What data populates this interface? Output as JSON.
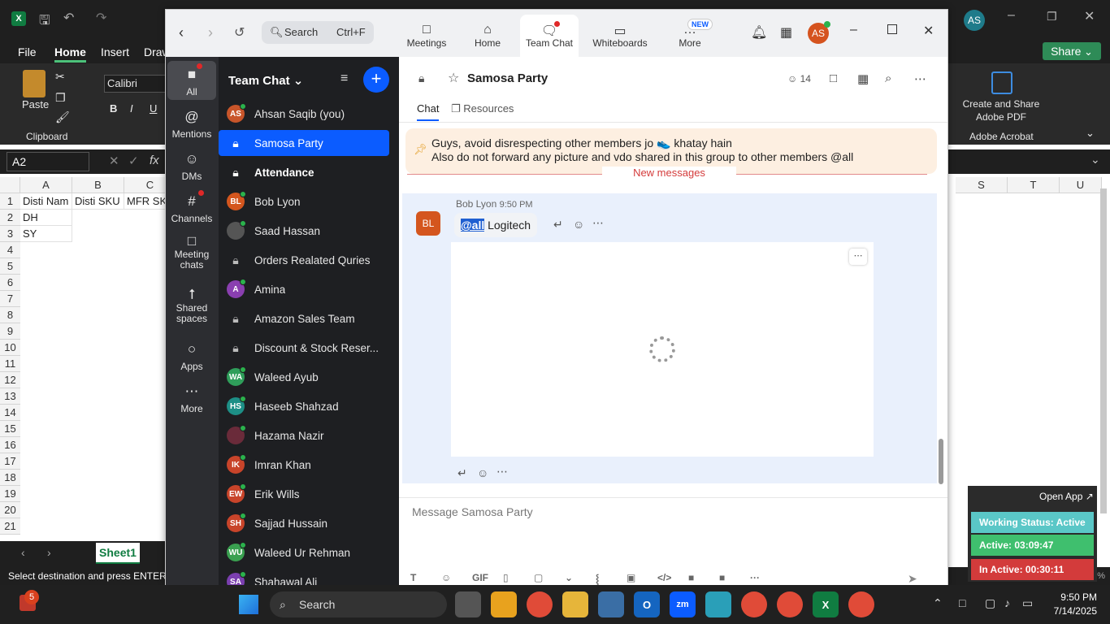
{
  "excel": {
    "menu_tabs": [
      "File",
      "Home",
      "Insert",
      "Draw"
    ],
    "font_name": "Calibri",
    "paste_label": "Paste",
    "clipboard_label": "Clipboard",
    "name_box": "A2",
    "create_share_pdf": "Create and Share Adobe PDF",
    "adobe_acrobat": "Adobe Acrobat",
    "share_label": "Share",
    "columns_left": [
      "A",
      "B",
      "C"
    ],
    "columns_right": [
      "S",
      "T",
      "U"
    ],
    "rows": [
      "1",
      "2",
      "3",
      "4",
      "5",
      "6",
      "7",
      "8",
      "9",
      "10",
      "11",
      "12",
      "13",
      "14",
      "15",
      "16",
      "17",
      "18",
      "19",
      "20",
      "21"
    ],
    "cells": {
      "A1": "Disti Nam",
      "B1": "Disti SKU",
      "C1": "MFR SK",
      "A2": "DH",
      "A3": "SY"
    },
    "sheet_tab": "Sheet1",
    "status_text": "Select destination and press ENTER or",
    "zoom_pct": "100%",
    "user_initials": "AS"
  },
  "zoom": {
    "search_placeholder": "Search",
    "search_shortcut": "Ctrl+F",
    "top_tabs": [
      {
        "label": "Meetings"
      },
      {
        "label": "Home"
      },
      {
        "label": "Team Chat"
      },
      {
        "label": "Whiteboards"
      },
      {
        "label": "More",
        "badge": "NEW"
      }
    ],
    "avatar_initials": "AS",
    "rail": [
      {
        "label": "All"
      },
      {
        "label": "Mentions"
      },
      {
        "label": "DMs"
      },
      {
        "label": "Channels"
      },
      {
        "label": "Meeting chats"
      },
      {
        "label": "Shared spaces"
      },
      {
        "label": "Apps"
      },
      {
        "label": "More"
      }
    ],
    "list_title": "Team Chat",
    "list": [
      {
        "name": "Ahsan Saqib (you)",
        "initials": "AS",
        "color": "#c8552a",
        "type": "user"
      },
      {
        "name": "Samosa Party",
        "type": "locked",
        "selected": true
      },
      {
        "name": "Attendance",
        "type": "locked",
        "bold": true
      },
      {
        "name": "Bob Lyon",
        "initials": "BL",
        "color": "#d4561e",
        "type": "user"
      },
      {
        "name": "Saad Hassan",
        "initials": "",
        "color": "#555",
        "type": "user"
      },
      {
        "name": "Orders Realated Quries",
        "type": "locked"
      },
      {
        "name": "Amina",
        "initials": "A",
        "color": "#8a3fb0",
        "type": "user"
      },
      {
        "name": "Amazon Sales Team",
        "type": "locked"
      },
      {
        "name": "Discount & Stock Reser...",
        "type": "locked"
      },
      {
        "name": "Waleed Ayub",
        "initials": "WA",
        "color": "#2f9e5a",
        "type": "user"
      },
      {
        "name": "Haseeb Shahzad",
        "initials": "HS",
        "color": "#1d8f86",
        "type": "user"
      },
      {
        "name": "Hazama Nazir",
        "initials": "",
        "color": "#6a2b3a",
        "type": "user"
      },
      {
        "name": "Imran Khan",
        "initials": "IK",
        "color": "#c8442a",
        "type": "user"
      },
      {
        "name": "Erik Wills",
        "initials": "EW",
        "color": "#c8442a",
        "type": "user"
      },
      {
        "name": "Sajjad Hussain",
        "initials": "SH",
        "color": "#c8442a",
        "type": "user"
      },
      {
        "name": "Waleed Ur Rehman",
        "initials": "WU",
        "color": "#3aa050",
        "type": "user"
      },
      {
        "name": "Shahawal Ali",
        "initials": "SA",
        "color": "#7b3fb0",
        "type": "user"
      }
    ],
    "channel_title": "Samosa Party",
    "member_count": "14",
    "chat_tabs": [
      "Chat",
      "Resources"
    ],
    "pinned": {
      "line1": "Guys, avoid disrespecting other members jo 👟 khatay hain",
      "line2": "Also do not forward any picture and vdo shared in this group to other members @all"
    },
    "new_messages": "New messages",
    "message": {
      "initials": "BL",
      "sender": "Bob Lyon",
      "time": "9:50 PM",
      "mention": "@all",
      "text": " Logitech"
    },
    "composer_placeholder": "Message Samosa Party",
    "composer_tools": [
      "T",
      "☺",
      "GIF",
      "▯",
      "▢",
      "⌄",
      "⸾",
      "▣",
      "</>",
      "■",
      "■",
      "···"
    ]
  },
  "status_widget": {
    "open_app": "Open App ↗",
    "working_status": "Working Status: Active",
    "active": "Active: 03:09:47",
    "inactive": "In Active: 00:30:11"
  },
  "taskbar": {
    "search": "Search",
    "time": "9:50 PM",
    "date": "7/14/2025",
    "notification_count": "5"
  }
}
